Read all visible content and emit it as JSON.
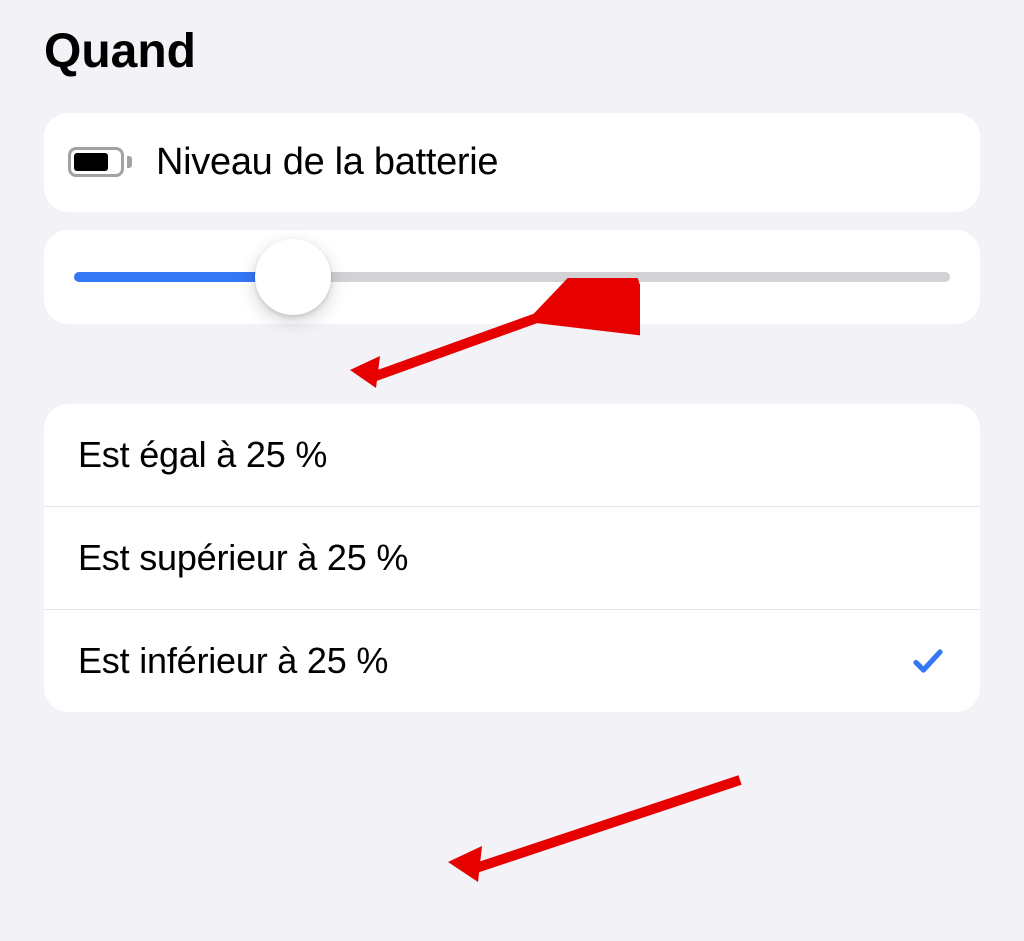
{
  "section_title": "Quand",
  "battery": {
    "label": "Niveau de la batterie"
  },
  "slider": {
    "percent": 25
  },
  "options": [
    {
      "label": "Est égal à 25 %",
      "selected": false
    },
    {
      "label": "Est supérieur à 25 %",
      "selected": false
    },
    {
      "label": "Est inférieur à 25 %",
      "selected": true
    }
  ]
}
